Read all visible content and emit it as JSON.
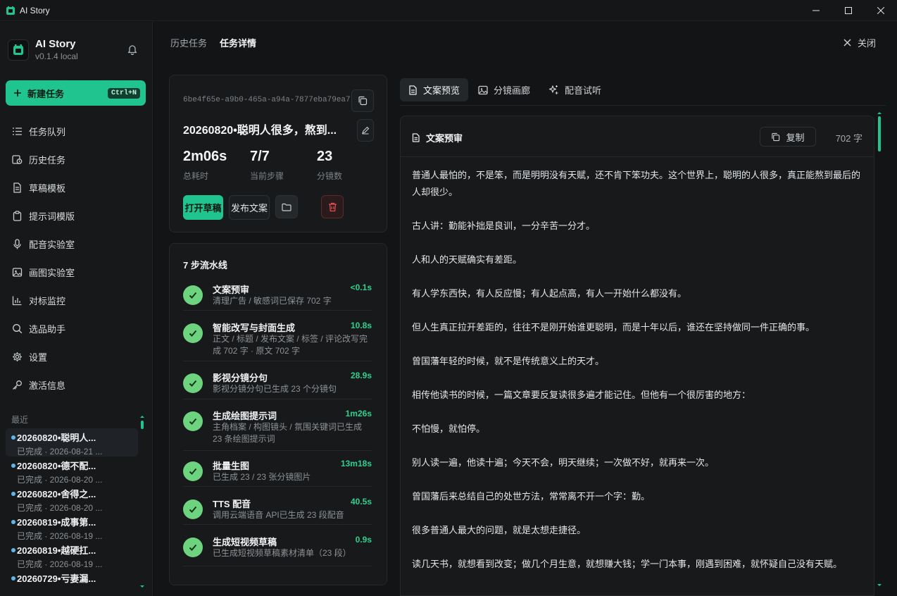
{
  "window": {
    "title": "AI Story"
  },
  "brand": {
    "name": "AI Story",
    "version": "v0.1.4 local"
  },
  "new_task": {
    "label": "新建任务",
    "shortcut": "Ctrl+N"
  },
  "nav": [
    {
      "label": "任务队列",
      "icon": "list-icon"
    },
    {
      "label": "历史任务",
      "icon": "history-icon"
    },
    {
      "label": "草稿模板",
      "icon": "document-icon"
    },
    {
      "label": "提示词模版",
      "icon": "clipboard-icon"
    },
    {
      "label": "配音实验室",
      "icon": "microphone-icon"
    },
    {
      "label": "画图实验室",
      "icon": "image-icon"
    },
    {
      "label": "对标监控",
      "icon": "bar-chart-icon"
    },
    {
      "label": "选品助手",
      "icon": "search-icon"
    },
    {
      "label": "设置",
      "icon": "gear-icon"
    },
    {
      "label": "激活信息",
      "icon": "key-icon"
    }
  ],
  "recent": {
    "label": "最近",
    "items": [
      {
        "title": "20260820•聪明人...",
        "sub": "已完成 · 2026-08-21 ..."
      },
      {
        "title": "20260820•德不配...",
        "sub": "已完成 · 2026-08-20 ..."
      },
      {
        "title": "20260820•舍得之...",
        "sub": "已完成 · 2026-08-20 ..."
      },
      {
        "title": "20260819•成事第...",
        "sub": "已完成 · 2026-08-19 ..."
      },
      {
        "title": "20260819•越硬扛...",
        "sub": "已完成 · 2026-08-19 ..."
      },
      {
        "title": "20260729•亏妻漏...",
        "sub": ""
      }
    ]
  },
  "header": {
    "crumb_history": "历史任务",
    "crumb_detail": "任务详情",
    "close_label": "关闭"
  },
  "task": {
    "id": "6be4f65e-a9b0-465a-a94a-7877eba79ea7",
    "title": "20260820•聪明人很多，熬到...",
    "stats": [
      {
        "value": "2m06s",
        "label": "总耗时"
      },
      {
        "value": "7/7",
        "label": "当前步骤"
      },
      {
        "value": "23",
        "label": "分镜数"
      }
    ],
    "open_draft": "打开草稿",
    "publish": "发布文案"
  },
  "pipeline": {
    "title": "7 步流水线",
    "steps": [
      {
        "name": "文案预审",
        "time": "<0.1s",
        "desc": "清理广告 / 敏感词已保存 702 字"
      },
      {
        "name": "智能改写与封面生成",
        "time": "10.8s",
        "desc": "正文 / 标题 / 发布文案 / 标签 / 评论改写完成 702 字 · 原文 702 字"
      },
      {
        "name": "影视分镜分句",
        "time": "28.9s",
        "desc": "影视分镜分句已生成 23 个分镜句"
      },
      {
        "name": "生成绘图提示词",
        "time": "1m26s",
        "desc": "主角档案 / 构图镜头 / 氛围关键词已生成 23 条绘图提示词"
      },
      {
        "name": "批量生图",
        "time": "13m18s",
        "desc": "已生成 23 / 23 张分镜图片"
      },
      {
        "name": "TTS 配音",
        "time": "40.5s",
        "desc": "调用云端语音 API已生成 23 段配音"
      },
      {
        "name": "生成短视频草稿",
        "time": "0.9s",
        "desc": "已生成短视频草稿素材清单（23 段）"
      }
    ]
  },
  "tabs": [
    {
      "label": "文案预览",
      "icon": "document-icon"
    },
    {
      "label": "分镜画廊",
      "icon": "image-icon"
    },
    {
      "label": "配音试听",
      "icon": "sparkle-icon"
    }
  ],
  "preview": {
    "title": "文案预审",
    "copy_label": "复制",
    "count": "702 字",
    "paragraphs": [
      "普通人最怕的，不是笨，而是明明没有天赋，还不肯下笨功夫。这个世界上，聪明的人很多，真正能熬到最后的人却很少。",
      "古人讲：勤能补拙是良训，一分辛苦一分才。",
      "人和人的天赋确实有差距。",
      "有人学东西快，有人反应慢；有人起点高，有人一开始什么都没有。",
      "但人生真正拉开差距的，往往不是刚开始谁更聪明，而是十年以后，谁还在坚持做同一件正确的事。",
      "曾国藩年轻的时候，就不是传统意义上的天才。",
      "相传他读书的时候，一篇文章要反复读很多遍才能记住。但他有一个很厉害的地方：",
      "不怕慢，就怕停。",
      "别人读一遍，他读十遍；今天不会，明天继续；一次做不好，就再来一次。",
      "曾国藩后来总结自己的处世方法，常常离不开一个字：勤。",
      "很多普通人最大的问题，就是太想走捷径。",
      "读几天书，就想看到改变；做几个月生意，就想赚大钱；学一门本事，刚遇到困难，就怀疑自己没有天赋。"
    ]
  },
  "colors": {
    "accent": "#1fc48e",
    "success": "#6ed37e",
    "danger": "#e05252",
    "background": "#121416"
  }
}
